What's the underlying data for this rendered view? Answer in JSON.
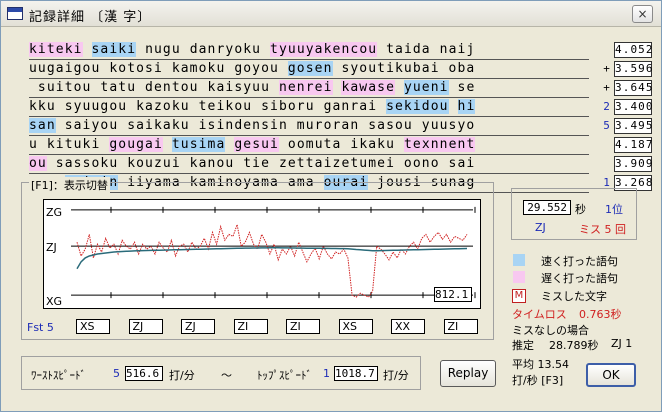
{
  "window": {
    "title": "記録詳細 〔漢 字〕",
    "close_label": "×"
  },
  "lines": [
    {
      "mark": "",
      "mark_color": "",
      "score": "4.052",
      "segments": [
        {
          "t": "kiteki",
          "h": "slow"
        },
        {
          "t": " ",
          "h": ""
        },
        {
          "t": "saiki",
          "h": "fast"
        },
        {
          "t": " nugu danryoku ",
          "h": ""
        },
        {
          "t": "tyuuyakencou",
          "h": "slow"
        },
        {
          "t": " taida naij",
          "h": ""
        }
      ]
    },
    {
      "mark": "+",
      "mark_color": "black",
      "score": "3.596",
      "segments": [
        {
          "t": "uugaigou kotosi kamoku goyou ",
          "h": ""
        },
        {
          "t": "gosen",
          "h": "fast"
        },
        {
          "t": " syoutikubai oba",
          "h": ""
        }
      ]
    },
    {
      "mark": "+",
      "mark_color": "black",
      "score": "3.645",
      "segments": [
        {
          "t": " suitou tatu dentou kaisyuu ",
          "h": ""
        },
        {
          "t": "nenrei",
          "h": "slow"
        },
        {
          "t": " ",
          "h": ""
        },
        {
          "t": "kawase",
          "h": "slow"
        },
        {
          "t": " ",
          "h": ""
        },
        {
          "t": "yueni",
          "h": "fast"
        },
        {
          "t": " se",
          "h": ""
        }
      ]
    },
    {
      "mark": "2",
      "mark_color": "blue",
      "score": "3.400",
      "segments": [
        {
          "t": "kku syuugou kazoku teikou siboru ganrai ",
          "h": ""
        },
        {
          "t": "sekidou",
          "h": "fast"
        },
        {
          "t": " ",
          "h": ""
        },
        {
          "t": "hi",
          "h": "fast"
        }
      ]
    },
    {
      "mark": "5",
      "mark_color": "blue",
      "score": "3.495",
      "segments": [
        {
          "t": "san",
          "h": "fast"
        },
        {
          "t": " saiyou saikaku isindensin muroran sasou yuusyo",
          "h": ""
        }
      ]
    },
    {
      "mark": "",
      "mark_color": "",
      "score": "4.187",
      "segments": [
        {
          "t": "u kituki ",
          "h": ""
        },
        {
          "t": "gougai",
          "h": "slow"
        },
        {
          "t": " ",
          "h": ""
        },
        {
          "t": "tusima",
          "h": "fast"
        },
        {
          "t": " ",
          "h": ""
        },
        {
          "t": "gesui",
          "h": "slow"
        },
        {
          "t": " oomuta ikaku ",
          "h": ""
        },
        {
          "t": "texnnent",
          "h": "slow"
        }
      ]
    },
    {
      "mark": "",
      "mark_color": "",
      "score": "3.909",
      "segments": [
        {
          "t": "ou",
          "h": "slow"
        },
        {
          "t": " sassoku kouzui kanou tie zettaizetumei oono sai",
          "h": ""
        }
      ]
    },
    {
      "mark": "1",
      "mark_color": "blue",
      "score": "3.268",
      "segments": [
        {
          "t": "nan ",
          "h": ""
        },
        {
          "t": "ruisin",
          "h": "fast"
        },
        {
          "t": " iiyama kaminoyama ama ",
          "h": ""
        },
        {
          "t": "ourai",
          "h": "fast"
        },
        {
          "t": " jousi sunag",
          "h": ""
        }
      ]
    }
  ],
  "chart_panel": {
    "label": "[F1]：表示切替",
    "y_labels": {
      "top": "ZG",
      "mid": "ZJ",
      "bottom": "XG"
    },
    "current_value": "812.1",
    "rank_prefix": "Fst 5",
    "ranks": [
      "XS",
      "ZJ",
      "ZJ",
      "ZI",
      "ZI",
      "XS",
      "XX",
      "ZI"
    ]
  },
  "chart_data": {
    "type": "line",
    "series": [
      {
        "values": [
          0.62,
          0.48,
          0.55,
          0.7,
          0.46,
          0.6,
          0.52,
          0.66,
          0.56,
          0.6,
          0.5,
          0.64,
          0.58,
          0.55,
          0.62,
          0.5,
          0.6,
          0.55,
          0.58,
          0.5,
          0.62,
          0.56,
          0.52,
          0.64,
          0.48,
          0.58,
          0.6,
          0.52,
          0.62,
          0.55,
          0.58,
          0.66,
          0.55,
          0.72,
          0.6,
          0.78,
          0.64,
          0.7,
          0.68,
          0.8,
          0.58,
          0.62,
          0.72,
          0.6,
          0.55,
          0.7,
          0.62,
          0.5,
          0.6,
          0.44,
          0.55,
          0.5,
          0.58,
          0.48,
          0.62,
          0.52,
          0.42,
          0.5,
          0.56,
          0.45,
          0.58,
          0.5,
          0.45,
          0.52,
          0.5,
          0.55,
          0.46,
          0.08,
          0.06,
          0.1,
          0.08,
          0.06,
          0.12,
          0.58,
          0.55,
          0.5,
          0.44,
          0.52,
          0.46,
          0.55,
          0.5,
          0.58,
          0.62,
          0.55,
          0.66,
          0.7,
          0.62,
          0.68,
          0.72,
          0.65,
          0.7,
          0.62,
          0.68,
          0.66,
          0.64,
          0.7
        ]
      },
      {
        "values": [
          0.35,
          0.42,
          0.46,
          0.48,
          0.49,
          0.5,
          0.505,
          0.51,
          0.515,
          0.52,
          0.523,
          0.526,
          0.528,
          0.53,
          0.532,
          0.534,
          0.535,
          0.536,
          0.537,
          0.538,
          0.539,
          0.54,
          0.541,
          0.542,
          0.543,
          0.544,
          0.545,
          0.546,
          0.547,
          0.548,
          0.549,
          0.55,
          0.551,
          0.552,
          0.553,
          0.554,
          0.555,
          0.556,
          0.557,
          0.558,
          0.559,
          0.56,
          0.56,
          0.561,
          0.561,
          0.562,
          0.562,
          0.563,
          0.563,
          0.563,
          0.562,
          0.562,
          0.561,
          0.561,
          0.56,
          0.56,
          0.559,
          0.559,
          0.558,
          0.558,
          0.557,
          0.557,
          0.556,
          0.556,
          0.555,
          0.555,
          0.554,
          0.55,
          0.546,
          0.543,
          0.54,
          0.537,
          0.534,
          0.534,
          0.535,
          0.536,
          0.537,
          0.538,
          0.539,
          0.54,
          0.541,
          0.542,
          0.543,
          0.544,
          0.545,
          0.546,
          0.547,
          0.548,
          0.549,
          0.55,
          0.551,
          0.552,
          0.553,
          0.554,
          0.555,
          0.556
        ]
      }
    ],
    "y_ticks": [
      "ZG",
      "ZJ",
      "XG"
    ],
    "grid": true
  },
  "result": {
    "seconds": "29.552",
    "sec_unit": "秒",
    "rank_place": "1位",
    "grade": "ZJ",
    "miss_text": "ミス 5 回"
  },
  "legend": {
    "fast_label": "速く打った語句",
    "slow_label": "遅く打った語句",
    "miss_icon": "M",
    "miss_label": "ミスした文字",
    "fast_color": "#a8d4f4",
    "slow_color": "#f8c8f0"
  },
  "loss": {
    "label": "タイムロス",
    "value": "0.763秒"
  },
  "no_miss": {
    "title": "ミスなしの場合",
    "estimate_label": "推定",
    "estimate_value": "28.789秒",
    "estimate_grade": "ZJ 1"
  },
  "average": {
    "line1": "平均 13.54",
    "line2": "打/秒 [F3]"
  },
  "speeds": {
    "worst_label": "ﾜｰｽﾄｽﾋﾟｰﾄﾞ",
    "worst_rank": "5",
    "worst_value": "516.6",
    "unit1": "打/分",
    "tilde": "〜",
    "top_label": "ﾄｯﾌﾟｽﾋﾟｰﾄﾞ",
    "top_rank": "1",
    "top_value": "1018.7",
    "unit2": "打/分"
  },
  "buttons": {
    "replay": "Replay",
    "ok": "OK"
  },
  "colors": {
    "accent_red": "#d02020",
    "accent_blue": "#1c2bb6",
    "series_red": "#d02020",
    "series_teal": "#2a6b7a"
  }
}
